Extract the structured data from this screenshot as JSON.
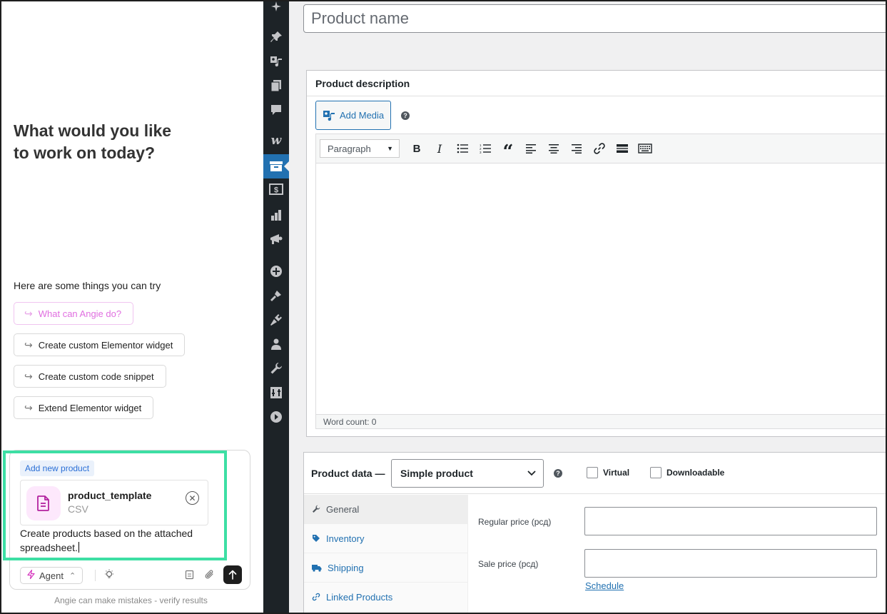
{
  "chat": {
    "heading_line1": "What would you like",
    "heading_line2": "to work on today?",
    "try_label": "Here are some things you can try",
    "suggestions": [
      "What can Angie do?",
      "Create custom Elementor widget",
      "Create custom code snippet",
      "Extend Elementor widget"
    ],
    "composer": {
      "tag": "Add new product",
      "attachment": {
        "name": "product_template",
        "type": "CSV"
      },
      "prompt_line1": "Create products based on the attached",
      "prompt_line2": "spreadsheet.",
      "mode_label": "Agent",
      "accent_color": "#3ddfa4"
    },
    "disclaimer": "Angie can make mistakes - verify results"
  },
  "wp_sidebar": {
    "items": [
      "ai-icon",
      "pin-icon",
      "media-icon",
      "pages-icon",
      "comments-icon",
      "woocommerce-icon",
      "products-icon",
      "payments-icon",
      "analytics-icon",
      "marketing-icon",
      "elementor-icon",
      "appearance-icon",
      "plugins-icon",
      "users-icon",
      "tools-icon",
      "settings-icon",
      "collapse-icon"
    ],
    "active_item": "products-icon",
    "active_color": "#2271b1"
  },
  "editor": {
    "title_placeholder": "Product name",
    "description_label": "Product description",
    "add_media_label": "Add Media",
    "format_select": "Paragraph",
    "word_count": "Word count: 0"
  },
  "product_data": {
    "label": "Product data —",
    "type_select": "Simple product",
    "virtual_label": "Virtual",
    "downloadable_label": "Downloadable",
    "tabs": [
      "General",
      "Inventory",
      "Shipping",
      "Linked Products"
    ],
    "active_tab": "General",
    "regular_price_label": "Regular price (рсд)",
    "sale_price_label": "Sale price (рсд)",
    "schedule_link": "Schedule"
  }
}
